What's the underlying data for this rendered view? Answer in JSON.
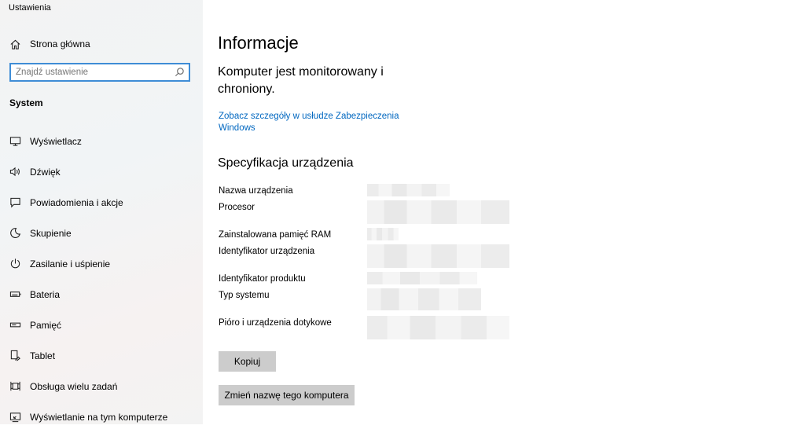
{
  "app": {
    "title": "Ustawienia"
  },
  "sidebar": {
    "home_label": "Strona główna",
    "search_placeholder": "Znajdź ustawienie",
    "section": "System",
    "items": [
      {
        "label": "Wyświetlacz",
        "icon": "monitor-icon"
      },
      {
        "label": "Dźwięk",
        "icon": "speaker-icon"
      },
      {
        "label": "Powiadomienia i akcje",
        "icon": "notification-icon"
      },
      {
        "label": "Skupienie",
        "icon": "moon-icon"
      },
      {
        "label": "Zasilanie i uśpienie",
        "icon": "power-icon"
      },
      {
        "label": "Bateria",
        "icon": "battery-icon"
      },
      {
        "label": "Pamięć",
        "icon": "storage-icon"
      },
      {
        "label": "Tablet",
        "icon": "tablet-icon"
      },
      {
        "label": "Obsługa wielu zadań",
        "icon": "multitasking-icon"
      },
      {
        "label": "Wyświetlanie na tym komputerze",
        "icon": "project-icon"
      }
    ]
  },
  "main": {
    "title": "Informacje",
    "protection_text": "Komputer jest monitorowany i chroniony.",
    "security_link": "Zobacz szczegóły w usłudze Zabezpieczenia Windows",
    "spec_heading": "Specyfikacja urządzenia",
    "spec_labels": [
      "Nazwa urządzenia",
      "Procesor",
      "Zainstalowana pamięć RAM",
      "Identyfikator urządzenia",
      "Identyfikator produktu",
      "Typ systemu",
      "Pióro i urządzenia dotykowe"
    ],
    "copy_button": "Kopiuj",
    "rename_button": "Zmień nazwę tego komputera"
  }
}
